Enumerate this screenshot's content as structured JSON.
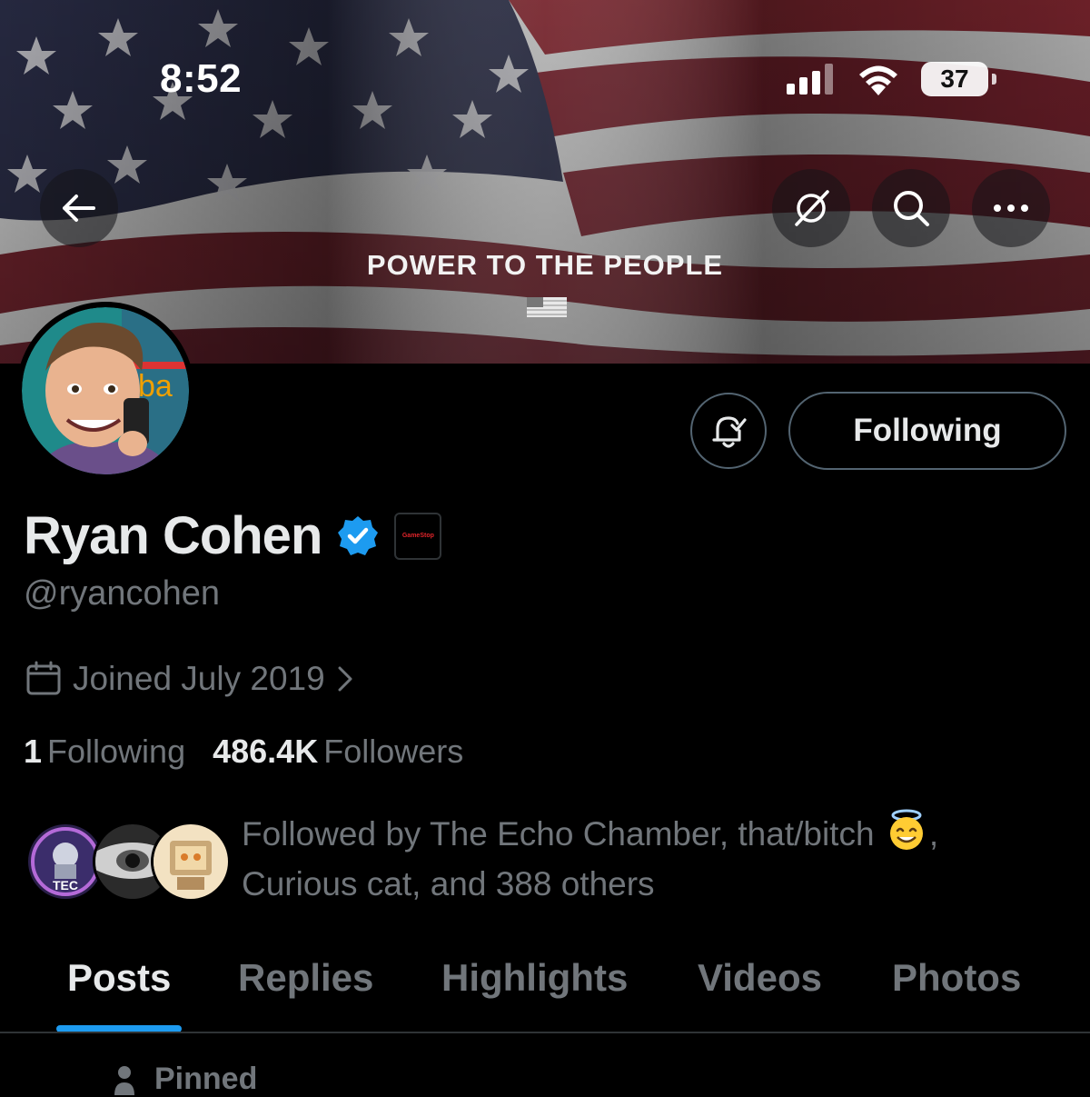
{
  "status_bar": {
    "time": "8:52",
    "battery": "37"
  },
  "banner": {
    "text": "POWER TO THE PEOPLE"
  },
  "profile": {
    "display_name": "Ryan Cohen",
    "handle": "@ryancohen",
    "verified": true,
    "affiliate_badge_text": "GameStop",
    "joined": "Joined July 2019",
    "following_count": "1",
    "following_label": "Following",
    "followers_count": "486.4K",
    "followers_label": "Followers",
    "followed_by_line1": "Followed by The Echo Chamber, that/bitch",
    "followed_by_line1_end": ",",
    "followed_by_line2": "Curious cat, and 388 others",
    "mini_avatar_tec_label": "TEC"
  },
  "actions": {
    "following_button": "Following"
  },
  "tabs": [
    {
      "label": "Posts",
      "active": true
    },
    {
      "label": "Replies",
      "active": false
    },
    {
      "label": "Highlights",
      "active": false
    },
    {
      "label": "Videos",
      "active": false
    },
    {
      "label": "Photos",
      "active": false
    }
  ],
  "pinned_label": "Pinned",
  "colors": {
    "accent": "#1d9bf0",
    "background": "#000000",
    "text_primary": "#e7e9ea",
    "text_secondary": "#71767b",
    "border": "#536471"
  },
  "icons": [
    "back-arrow-icon",
    "grok-icon",
    "search-icon",
    "more-icon",
    "bell-check-icon",
    "verified-check-icon",
    "calendar-icon",
    "chevron-right-icon",
    "pin-icon"
  ]
}
